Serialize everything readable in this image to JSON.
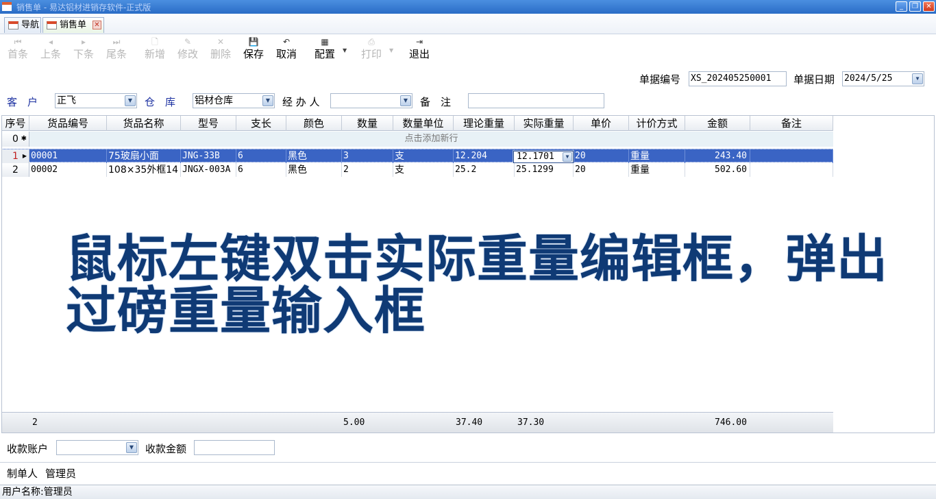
{
  "window": {
    "title": "销售单 - 易达铝材进销存软件-正式版",
    "buttons": {
      "minimize": "_",
      "restore": "❐",
      "close": "✕"
    }
  },
  "tabs": [
    {
      "label": "导航",
      "active": false
    },
    {
      "label": "销售单",
      "active": true,
      "close": "✕"
    }
  ],
  "toolbar": {
    "first": "首条",
    "prev": "上条",
    "next": "下条",
    "last": "尾条",
    "add": "新增",
    "edit": "修改",
    "delete": "删除",
    "save": "保存",
    "cancel": "取消",
    "config": "配置",
    "print": "打印",
    "exit": "退出"
  },
  "header": {
    "doc_no_label": "单据编号",
    "doc_no": "XS_202405250001",
    "doc_date_label": "单据日期",
    "doc_date": "2024/5/25",
    "customer_label": "客　户",
    "customer": "正飞",
    "warehouse_label": "仓　库",
    "warehouse": "铝材仓库",
    "handler_label": "经 办 人",
    "handler": "",
    "remark_label": "备　注",
    "remark": ""
  },
  "grid": {
    "columns": [
      "序号",
      "货品编号",
      "货品名称",
      "型号",
      "支长",
      "颜色",
      "数量",
      "数量单位",
      "理论重量",
      "实际重量",
      "单价",
      "计价方式",
      "金额",
      "备注"
    ],
    "new_row_index": "0",
    "new_row_hint": "点击添加新行",
    "rows": [
      {
        "index": "1",
        "code": "00001",
        "name": "75玻扇小面",
        "model": "JNG-33B",
        "length": "6",
        "color": "黑色",
        "qty": "3",
        "unit": "支",
        "theory_weight": "12.204",
        "actual_weight": "12.1701",
        "price": "20",
        "pricing": "重量",
        "amount": "243.40",
        "remark": ""
      },
      {
        "index": "2",
        "code": "00002",
        "name": "108×35外框14",
        "model": "JNGX-003A",
        "length": "6",
        "color": "黑色",
        "qty": "2",
        "unit": "支",
        "theory_weight": "25.2",
        "actual_weight": "25.1299",
        "price": "20",
        "pricing": "重量",
        "amount": "502.60",
        "remark": ""
      }
    ],
    "footer": {
      "count": "2",
      "qty_total": "5.00",
      "theory_total": "37.40",
      "actual_total": "37.30",
      "amount_total": "746.00"
    }
  },
  "overlay_text": "鼠标左键双击实际重量编辑框，弹出过磅重量输入框",
  "payment": {
    "account_label": "收款账户",
    "account": "",
    "amount_label": "收款金额",
    "amount": ""
  },
  "maker": {
    "label": "制单人",
    "value": "管理员"
  },
  "status": {
    "user_text": "用户名称:管理员"
  }
}
